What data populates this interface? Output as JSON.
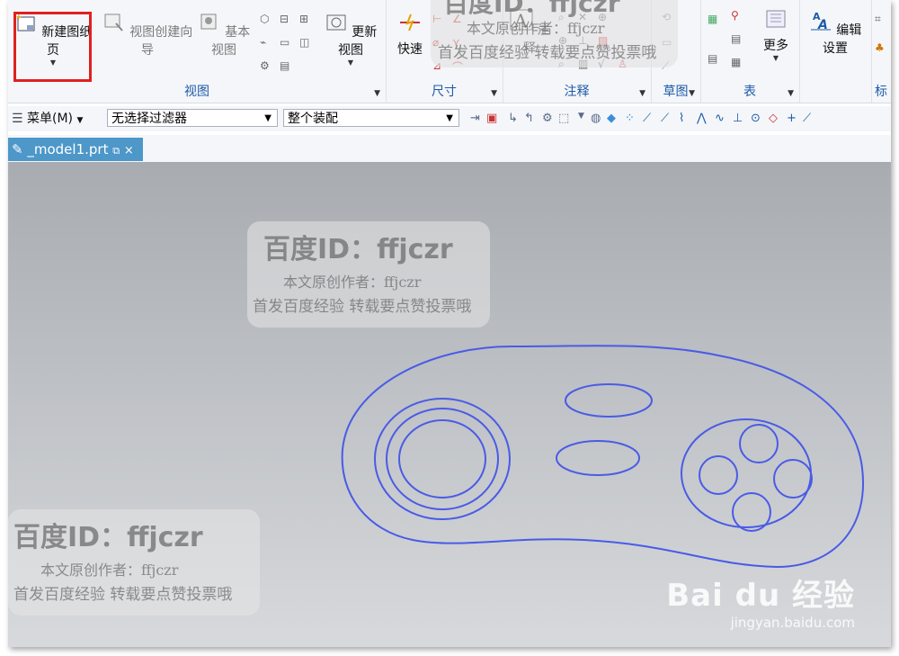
{
  "ribbon": {
    "new_sheet": "新建图纸页",
    "view_wizard": "视图创建向导",
    "base_view": "基本视图",
    "update_view": "更新视图",
    "group_view": "视图",
    "quick": "快速",
    "group_dimension": "尺寸",
    "annotation": "注释",
    "group_annotation": "注释",
    "group_sketch": "草图",
    "more": "更多",
    "group_table": "表",
    "edit_settings": "编辑设置",
    "group_partial": "标"
  },
  "toolbar": {
    "menu": "菜单(M)",
    "filter": "无选择过滤器",
    "assembly": "整个装配"
  },
  "tab": {
    "label": "_model1.prt"
  },
  "watermarks": {
    "id_text": "百度ID：ffjczr",
    "author": "本文原创作者：ffjczr",
    "notice": "首发百度经验 转载要点赞投票哦",
    "top_id_text": "百度ID：ffjczr",
    "top_author": "本文原创作者：ffjczr",
    "top_notice": "首发百度经验 转载要点赞投票哦"
  },
  "brand": {
    "logo": "Bai du 经验",
    "url": "jingyan.baidu.com"
  },
  "colors": {
    "geometry_stroke": "#4a5be6",
    "highlight": "#e02020",
    "tab_bg": "#4d97c9",
    "label_blue": "#1e5aa8"
  }
}
